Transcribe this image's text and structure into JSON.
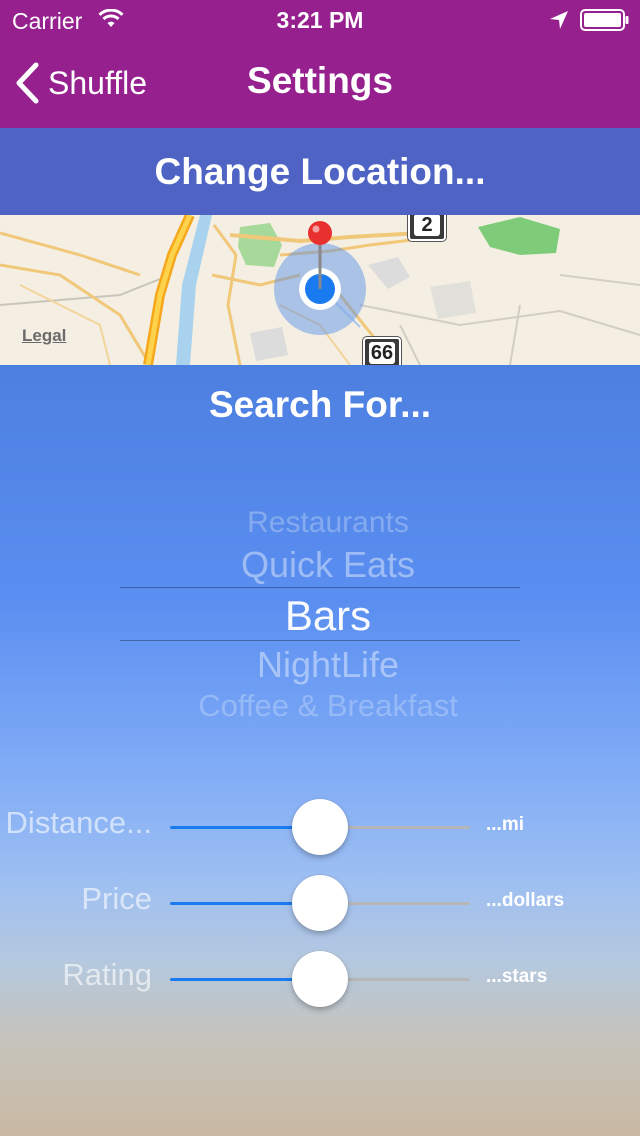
{
  "status_bar": {
    "carrier": "Carrier",
    "time": "3:21 PM"
  },
  "nav": {
    "back_label": "Shuffle",
    "title": "Settings"
  },
  "change_location": {
    "label": "Change Location..."
  },
  "map": {
    "legal": "Legal",
    "route_badges": [
      "2",
      "66"
    ]
  },
  "search": {
    "heading": "Search For...",
    "options": [
      "Restaurants",
      "Quick Eats",
      "Bars",
      "NightLife",
      "Coffee & Breakfast"
    ],
    "selected": "Bars"
  },
  "sliders": [
    {
      "label": "Distance...",
      "unit": "...mi",
      "value": 0.5
    },
    {
      "label": "Price",
      "unit": "...dollars",
      "value": 0.5
    },
    {
      "label": "Rating",
      "unit": "...stars",
      "value": 0.5
    }
  ],
  "colors": {
    "nav_bar": "#95208e",
    "change_location_bar": "#4e63c4",
    "slider_fill": "#1a7af0",
    "location_dot": "#1a7af0",
    "pin": "#e8302f"
  }
}
